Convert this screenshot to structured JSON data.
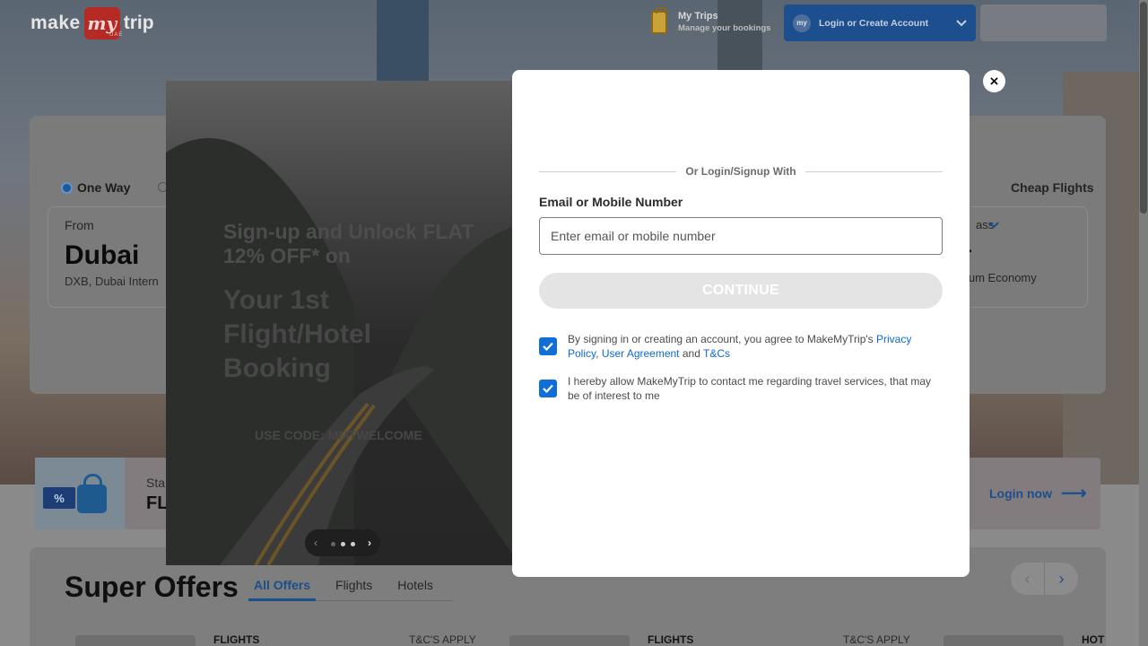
{
  "header": {
    "logo": {
      "make": "make",
      "my": "my",
      "trip": "trip",
      "region": "UAE"
    },
    "my_trips": {
      "title": "My Trips",
      "subtitle": "Manage your bookings"
    },
    "login": {
      "avatar_text": "my",
      "label": "Login or Create Account"
    }
  },
  "search": {
    "trip_type_selected": "One Way",
    "cheap_flights": "Cheap Flights",
    "from": {
      "label": "From",
      "city": "Dubai",
      "airport": "DXB, Dubai Intern"
    },
    "travel_class": {
      "label": "ass",
      "value_letter": "r",
      "value": "ium Economy"
    }
  },
  "promo_banner": {
    "ticket_symbol": "%",
    "line1": "Sta",
    "line2": "FL",
    "login_now": "Login now",
    "arrow": "⟶"
  },
  "offers": {
    "title": "Super Offers",
    "tabs": [
      {
        "label": "All Offers",
        "active": true
      },
      {
        "label": "Flights",
        "active": false
      },
      {
        "label": "Hotels",
        "active": false
      }
    ],
    "cards": [
      {
        "category": "FLIGHTS",
        "tnc": "T&C'S APPLY"
      },
      {
        "category": "FLIGHTS",
        "tnc": "T&C'S APPLY"
      },
      {
        "category": "HOT",
        "tnc": ""
      }
    ]
  },
  "promo_panel": {
    "signup_text": "Sign-up and Unlock FLAT 12% OFF* on",
    "headline": "Your 1st Flight/Hotel Booking",
    "code": "USE CODE: MMTWELCOME",
    "carousel": {
      "prev": "‹",
      "next": "›",
      "dots": 3,
      "active_dot": 0
    }
  },
  "modal": {
    "close": "×",
    "divider": "Or Login/Signup With",
    "email_label": "Email or Mobile Number",
    "email_placeholder": "Enter email or mobile number",
    "email_value": "",
    "continue_label": "CONTINUE",
    "consent1": {
      "checked": true,
      "prefix": "By signing in or creating an account, you agree to MakeMyTrip's ",
      "privacy": "Privacy Policy",
      "comma": ",",
      "agreement": "User Agreement",
      "and": " and ",
      "tcs": "T&Cs"
    },
    "consent2": {
      "checked": true,
      "text": "I hereby allow MakeMyTrip to contact me regarding travel services, that may be of interest to me"
    }
  },
  "colors": {
    "accent": "#0f6fd6",
    "link": "#1169d0",
    "brand_red": "#b52a24",
    "continue_disabled": "#e4e4e4"
  },
  "icons": {
    "close": "close-icon",
    "suitcase": "suitcase-icon",
    "chevron": "chevron-down-icon",
    "check": "check-icon",
    "arrow": "arrow-right-icon"
  }
}
